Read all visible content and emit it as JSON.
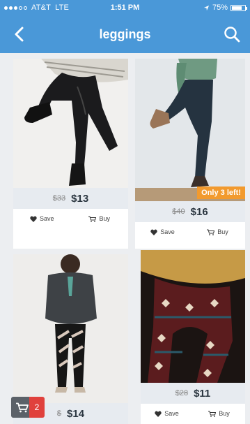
{
  "status_bar": {
    "carrier": "AT&T",
    "network": "LTE",
    "time": "1:51 PM",
    "battery": "75%",
    "battery_level": 0.75
  },
  "nav": {
    "title": "leggings",
    "back_icon": "chevron-left-icon",
    "search_icon": "search-icon"
  },
  "products": [
    {
      "old_price": "$33",
      "price": "$13",
      "save_label": "Save",
      "buy_label": "Buy"
    },
    {
      "old_price": "$40",
      "price": "$16",
      "save_label": "Save",
      "buy_label": "Buy",
      "badge": "Only 3 left!"
    },
    {
      "old_price": "$",
      "price": "$14"
    },
    {
      "old_price": "$28",
      "price": "$11",
      "save_label": "Save",
      "buy_label": "Buy"
    }
  ],
  "cart": {
    "count": "2"
  },
  "colors": {
    "header": "#4a98d8",
    "badge": "#f29a2e",
    "cart_count": "#e0413c"
  }
}
